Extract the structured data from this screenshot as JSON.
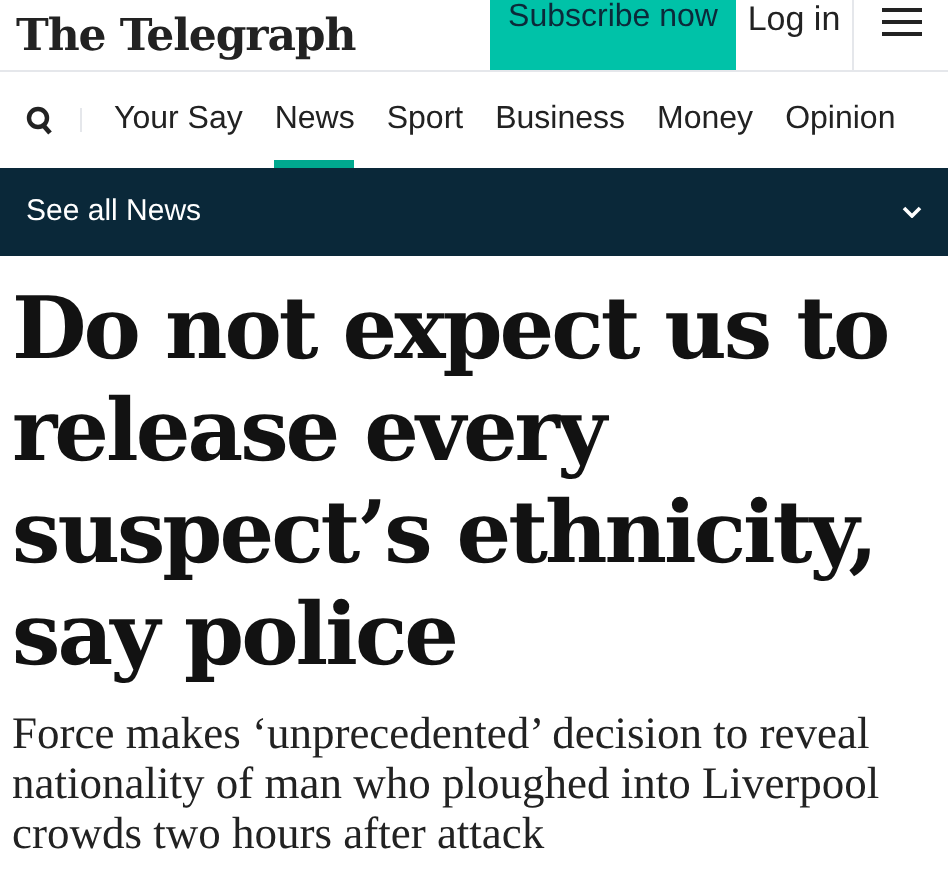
{
  "header": {
    "logo": "The Telegraph",
    "subscribe": "Subscribe now",
    "login": "Log in"
  },
  "nav": {
    "items": [
      {
        "label": "Your Say",
        "selected": false
      },
      {
        "label": "News",
        "selected": true
      },
      {
        "label": "Sport",
        "selected": false
      },
      {
        "label": "Business",
        "selected": false
      },
      {
        "label": "Money",
        "selected": false
      },
      {
        "label": "Opinion",
        "selected": false
      }
    ]
  },
  "section_bar": {
    "label": "See all News"
  },
  "article": {
    "headline": "Do not expect us to release every suspect’s ethnicity, say police",
    "standfirst": "Force makes ‘unprecedented’ decision to reveal nationality of man who ploughed into Liverpool crowds two hours after attack"
  }
}
